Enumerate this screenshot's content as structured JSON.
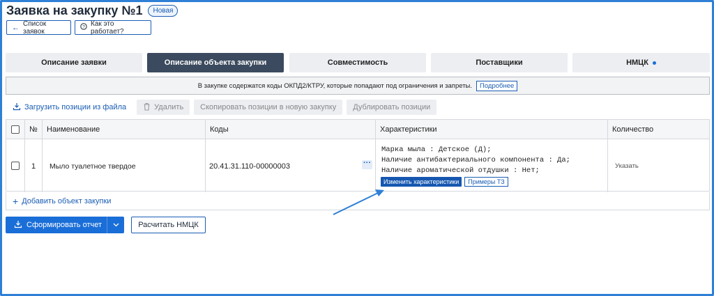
{
  "header": {
    "title": "Заявка на закупку №1",
    "status_badge": "Новая",
    "back_label": "Список заявок",
    "help_label": "Как это работает?"
  },
  "tabs": [
    {
      "label": "Описание заявки",
      "active": false
    },
    {
      "label": "Описание объекта закупки",
      "active": true
    },
    {
      "label": "Совместимость",
      "active": false
    },
    {
      "label": "Поставщики",
      "active": false
    },
    {
      "label": "НМЦК",
      "active": false
    }
  ],
  "notice": {
    "text": "В закупке содержатся коды ОКПД2/КТРУ, которые попадают под ограничения и запреты.",
    "more_label": "Подробнее"
  },
  "toolbar": {
    "upload_label": "Загрузить позиции из файла",
    "delete_label": "Удалить",
    "copy_label": "Скопировать позиции в новую закупку",
    "duplicate_label": "Дублировать позиции"
  },
  "table": {
    "columns": [
      "№",
      "Наименование",
      "Коды",
      "Характеристики",
      "Количество"
    ],
    "rows": [
      {
        "num": "1",
        "name": "Мыло туалетное твердое",
        "code": "20.41.31.110-00000003",
        "characteristics": [
          "Марка мыла :  Детское (Д);",
          "Наличие антибактериального компонента :  Да;",
          "Наличие ароматической отдушки :  Нет;"
        ],
        "edit_chars_label": "Изменить характеристики",
        "examples_label": "Примеры ТЗ",
        "quantity_label": "Указать"
      }
    ],
    "add_label": "Добавить объект закупки"
  },
  "footer": {
    "report_label": "Сформировать отчет",
    "nmck_label": "Расчитать НМЦК"
  },
  "colors": {
    "accent": "#1a6ed8",
    "active_tab": "#3b4a5e",
    "annotation_arrow": "#2f7fd6"
  }
}
